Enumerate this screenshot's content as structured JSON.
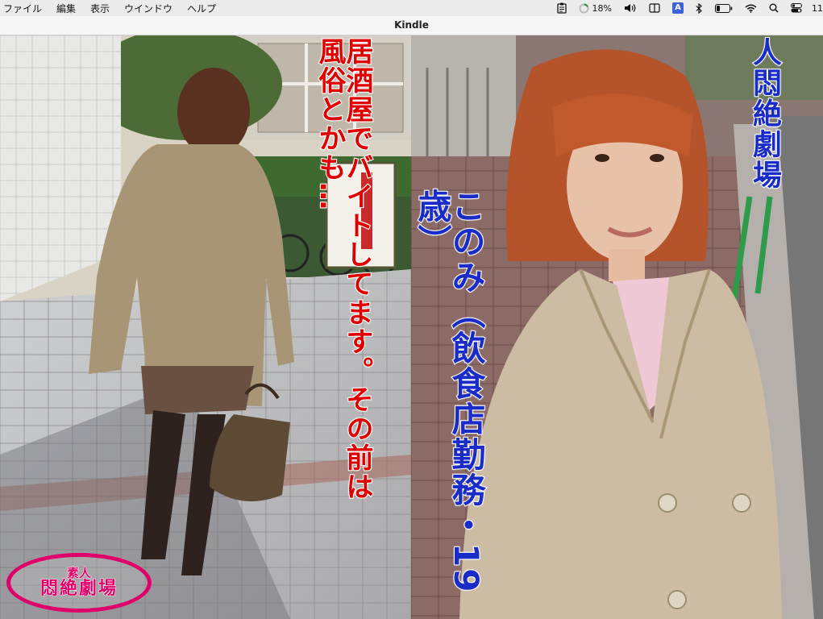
{
  "menubar": {
    "items": [
      "ファイル",
      "編集",
      "表示",
      "ウインドウ",
      "ヘルプ"
    ],
    "battery_percent": "18%",
    "clock_partial": "11"
  },
  "window": {
    "title": "Kindle"
  },
  "book": {
    "left_caption": "居酒屋でバイトしてます。その前は風俗とかも…",
    "left_logo": [
      "素人",
      "悶絶劇場"
    ],
    "right_title": "人悶絶劇場",
    "right_caption": "このみ（飲食店勤務・19歳）"
  },
  "colors": {
    "caption_red": "#e00000",
    "caption_blue": "#1a2cc8",
    "logo_magenta": "#e0006a"
  }
}
